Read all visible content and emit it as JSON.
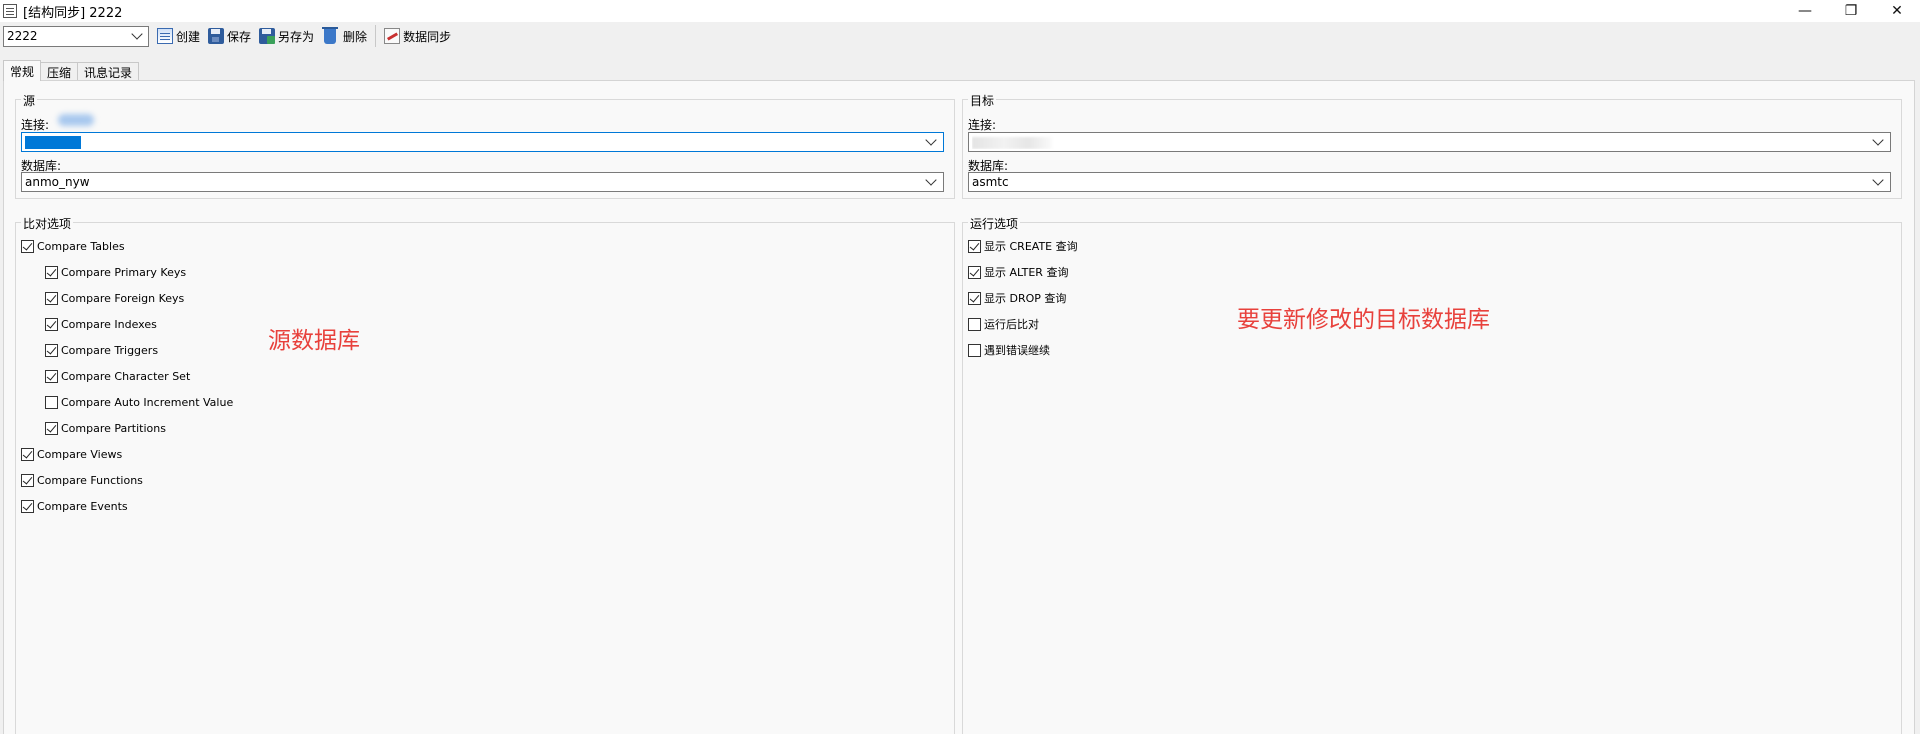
{
  "window": {
    "title": "[结构同步] 2222",
    "controls": {
      "minimize": "—",
      "restore": "❐",
      "close": "✕"
    }
  },
  "toolbar": {
    "profile_value": "2222",
    "create_label": "创建",
    "save_label": "保存",
    "saveas_label": "另存为",
    "delete_label": "删除",
    "sync_label": "数据同步"
  },
  "tabs": [
    {
      "label": "常规",
      "active": true
    },
    {
      "label": "压缩",
      "active": false
    },
    {
      "label": "讯息记录",
      "active": false
    }
  ],
  "source": {
    "title": "源",
    "connection_label": "连接:",
    "connection_value": "",
    "database_label": "数据库:",
    "database_value": "anmo_nyw"
  },
  "target": {
    "title": "目标",
    "connection_label": "连接:",
    "connection_value": "",
    "database_label": "数据库:",
    "database_value": "asmtc"
  },
  "compare_options": {
    "title": "比对选项",
    "items": [
      {
        "label": "Compare Tables",
        "checked": true,
        "indent": 0
      },
      {
        "label": "Compare Primary Keys",
        "checked": true,
        "indent": 1
      },
      {
        "label": "Compare Foreign Keys",
        "checked": true,
        "indent": 1
      },
      {
        "label": "Compare Indexes",
        "checked": true,
        "indent": 1
      },
      {
        "label": "Compare Triggers",
        "checked": true,
        "indent": 1
      },
      {
        "label": "Compare Character Set",
        "checked": true,
        "indent": 1
      },
      {
        "label": "Compare Auto Increment Value",
        "checked": false,
        "indent": 1
      },
      {
        "label": "Compare Partitions",
        "checked": true,
        "indent": 1
      },
      {
        "label": "Compare Views",
        "checked": true,
        "indent": 0
      },
      {
        "label": "Compare Functions",
        "checked": true,
        "indent": 0
      },
      {
        "label": "Compare Events",
        "checked": true,
        "indent": 0
      }
    ]
  },
  "run_options": {
    "title": "运行选项",
    "items": [
      {
        "label": "显示 CREATE 查询",
        "checked": true
      },
      {
        "label": "显示 ALTER 查询",
        "checked": true
      },
      {
        "label": "显示 DROP 查询",
        "checked": true
      },
      {
        "label": "运行后比对",
        "checked": false
      },
      {
        "label": "遇到错误继续",
        "checked": false
      }
    ]
  },
  "annotations": {
    "source_note": "源数据库",
    "target_note": "要更新修改的目标数据库"
  },
  "colors": {
    "annotation": "#e8413c",
    "focus": "#0078d7"
  }
}
